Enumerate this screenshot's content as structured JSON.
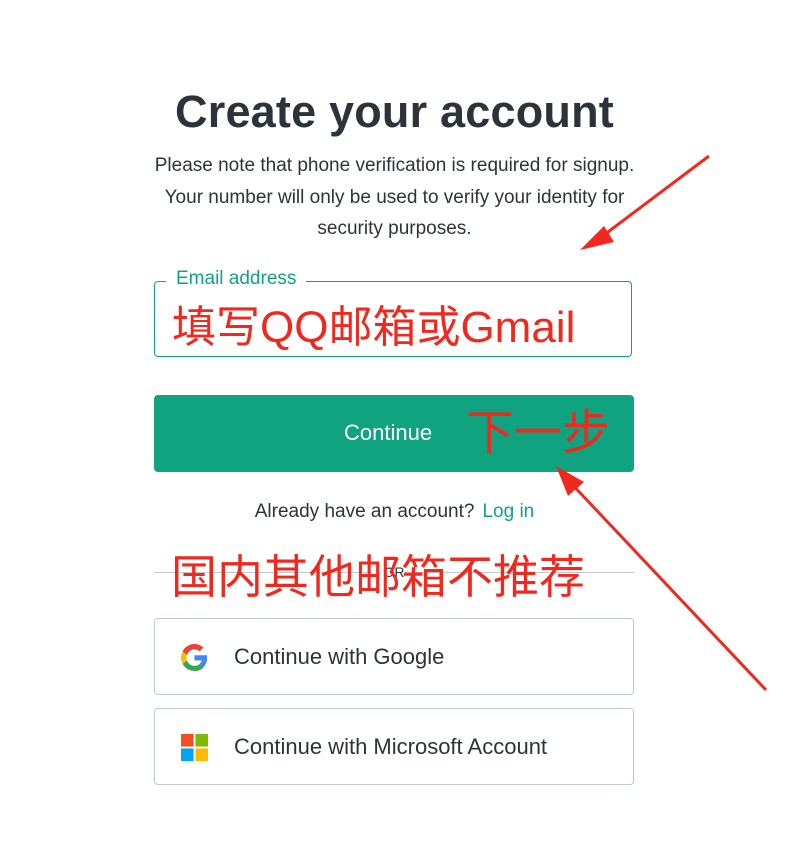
{
  "header": {
    "title": "Create your account",
    "subtitle": "Please note that phone verification is required for signup. Your number will only be used to verify your identity for security purposes."
  },
  "email": {
    "label": "Email address",
    "value": "填写QQ邮箱或Gmail"
  },
  "continue_button": {
    "label": "Continue"
  },
  "login": {
    "prompt": "Already have an account?",
    "link": "Log in"
  },
  "divider": {
    "text": "OR"
  },
  "social": [
    {
      "label": "Continue with Google",
      "icon": "google-icon"
    },
    {
      "label": "Continue with Microsoft Account",
      "icon": "microsoft-icon"
    }
  ],
  "annotations": {
    "next_step": "下一步",
    "other_email": "国内其他邮箱不推荐"
  },
  "colors": {
    "accent": "#10a37f",
    "annotation": "#f0281e",
    "text": "#2d333a",
    "border": "#c2c8d0"
  }
}
